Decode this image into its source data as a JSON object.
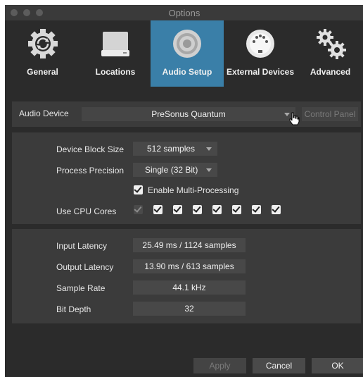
{
  "window": {
    "title": "Options"
  },
  "tabs": [
    {
      "label": "General",
      "icon": "gear-refresh-icon"
    },
    {
      "label": "Locations",
      "icon": "drive-icon"
    },
    {
      "label": "Audio Setup",
      "icon": "speaker-icon",
      "active": true
    },
    {
      "label": "External Devices",
      "icon": "midi-port-icon"
    },
    {
      "label": "Advanced",
      "icon": "gears-icon"
    }
  ],
  "audio_device": {
    "label": "Audio Device",
    "value": "PreSonus Quantum",
    "control_panel": "Control Panel"
  },
  "settings": {
    "block_size_label": "Device Block Size",
    "block_size_value": "512 samples",
    "precision_label": "Process Precision",
    "precision_value": "Single (32 Bit)",
    "multiprocessing_label": "Enable Multi-Processing",
    "multiprocessing_checked": true,
    "cpu_cores_label": "Use CPU Cores",
    "cpu_cores": [
      true,
      true,
      true,
      true,
      true,
      true,
      true,
      true
    ]
  },
  "latency": {
    "input_label": "Input Latency",
    "input_value": "25.49 ms / 1124 samples",
    "output_label": "Output Latency",
    "output_value": "13.90 ms / 613 samples",
    "sample_rate_label": "Sample Rate",
    "sample_rate_value": "44.1 kHz",
    "bit_depth_label": "Bit Depth",
    "bit_depth_value": "32"
  },
  "footer": {
    "apply": "Apply",
    "cancel": "Cancel",
    "ok": "OK"
  },
  "colors": {
    "accent_tab": "#3a7fa8",
    "window_bg": "#2b2b2b",
    "panel_bg": "#3b3b3b"
  }
}
